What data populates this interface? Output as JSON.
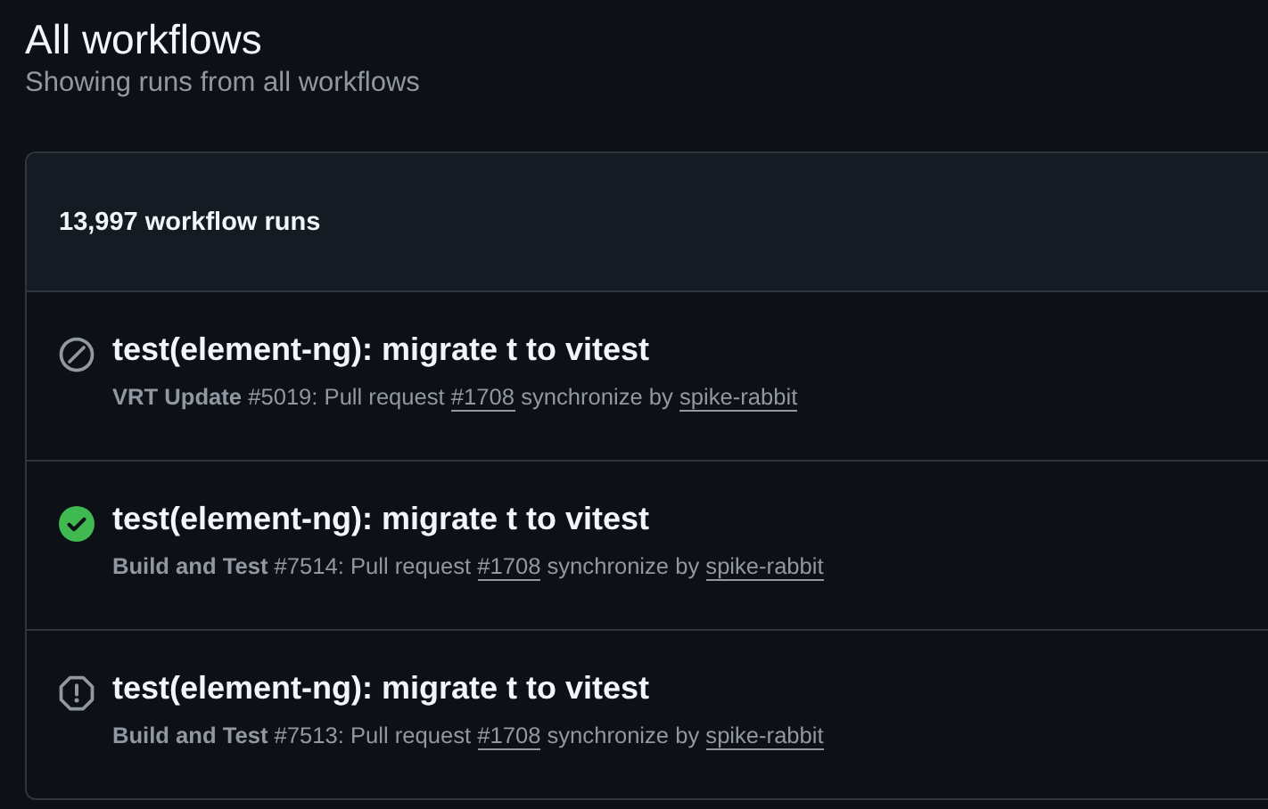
{
  "header": {
    "title": "All workflows",
    "subtitle": "Showing runs from all workflows"
  },
  "runs_box": {
    "count": "13,997 workflow runs",
    "runs": [
      {
        "kind": "cancelled",
        "title": "test(element-ng): migrate t to vitest",
        "workflow": "VRT Update",
        "run_text": " #5019: Pull request ",
        "pr": "#1708",
        "event_text": " synchronize by ",
        "author": "spike-rabbit"
      },
      {
        "kind": "success",
        "title": "test(element-ng): migrate t to vitest",
        "workflow": "Build and Test",
        "run_text": " #7514: Pull request ",
        "pr": "#1708",
        "event_text": " synchronize by ",
        "author": "spike-rabbit"
      },
      {
        "kind": "failure",
        "title": "test(element-ng): migrate t to vitest",
        "workflow": "Build and Test",
        "run_text": " #7513: Pull request ",
        "pr": "#1708",
        "event_text": " synchronize by ",
        "author": "spike-rabbit"
      }
    ]
  }
}
